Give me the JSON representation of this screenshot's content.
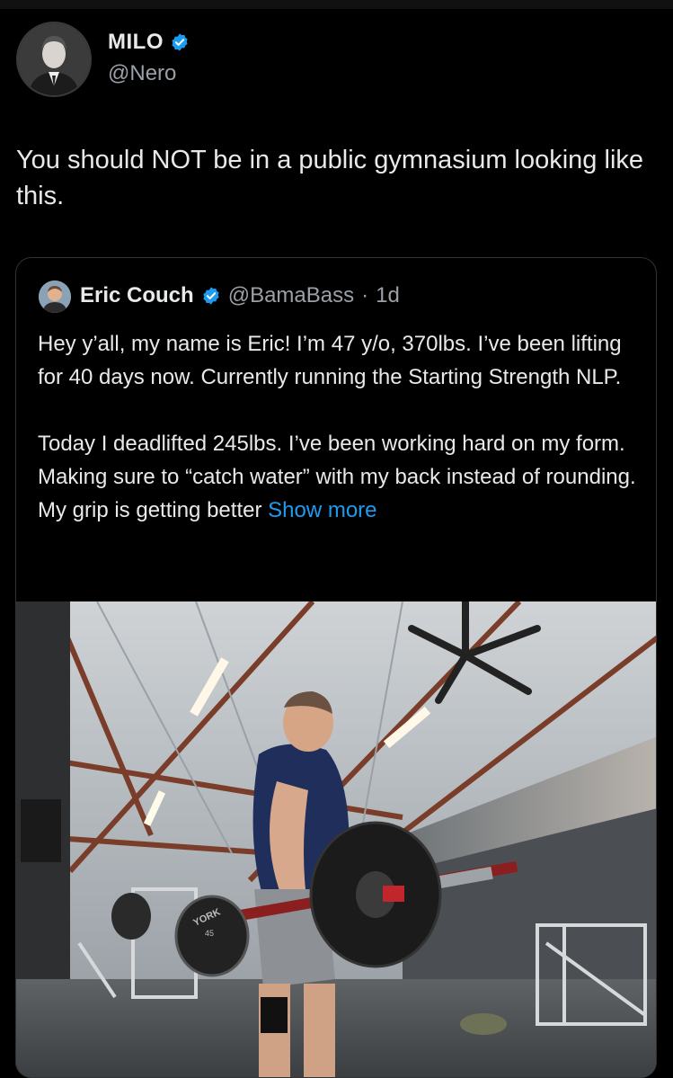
{
  "tweet": {
    "author_name": "MILO",
    "author_handle": "@Nero",
    "text": "You should NOT be in a public gymnasium looking like this."
  },
  "quoted_tweet": {
    "author_name": "Eric Couch",
    "author_handle": "@BamaBass",
    "separator": "·",
    "time": "1d",
    "paragraph_1": "Hey y’all, my name is Eric! I’m 47 y/o, 370lbs. I’ve been lifting for 40 days now. Currently running the Starting Strength NLP.",
    "paragraph_2": "Today I deadlifted 245lbs. I’ve been working hard on my form. Making sure to “catch water” with my back instead of rounding. My grip is getting better",
    "show_more_label": "Show more",
    "media": {
      "plate_brand": "YORK",
      "plate_weight": "45"
    }
  },
  "colors": {
    "background": "#000000",
    "text": "#e7e9ea",
    "secondary_text": "#9aa0a6",
    "link": "#1d9bf0",
    "verified_badge": "#1d9bf0",
    "card_border": "#333333"
  }
}
